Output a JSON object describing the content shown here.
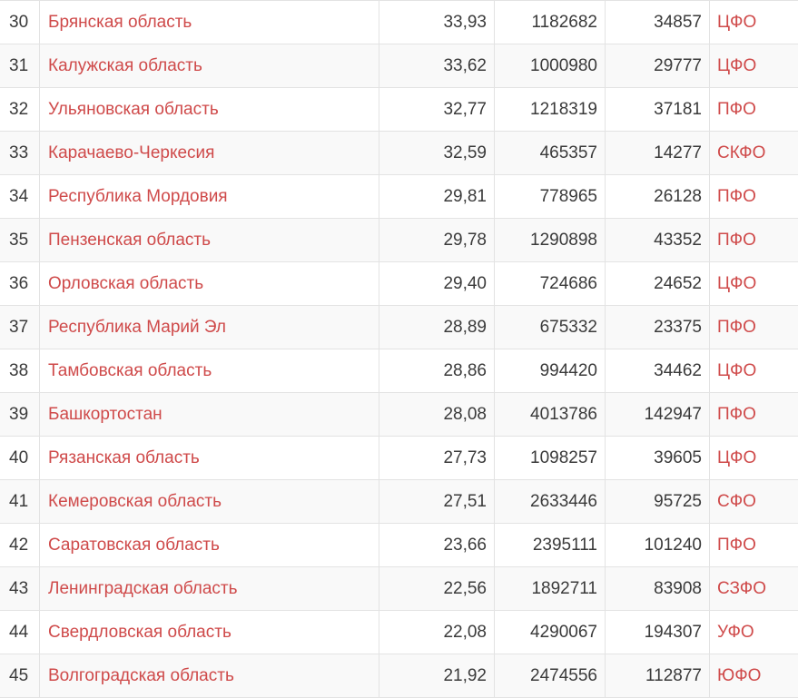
{
  "theme": {
    "link_color": "#cf4a4a",
    "text_color": "#3a3a3a",
    "border_color": "#e3e3e3",
    "stripe_color": "#f9f9f9"
  },
  "rows": [
    {
      "rank": "30",
      "name": "Брянская область",
      "percent": "33,93",
      "population": "1182682",
      "count": "34857",
      "district": "ЦФО"
    },
    {
      "rank": "31",
      "name": "Калужская область",
      "percent": "33,62",
      "population": "1000980",
      "count": "29777",
      "district": "ЦФО"
    },
    {
      "rank": "32",
      "name": "Ульяновская область",
      "percent": "32,77",
      "population": "1218319",
      "count": "37181",
      "district": "ПФО"
    },
    {
      "rank": "33",
      "name": "Карачаево-Черкесия",
      "percent": "32,59",
      "population": "465357",
      "count": "14277",
      "district": "СКФО"
    },
    {
      "rank": "34",
      "name": "Республика Мордовия",
      "percent": "29,81",
      "population": "778965",
      "count": "26128",
      "district": "ПФО"
    },
    {
      "rank": "35",
      "name": "Пензенская область",
      "percent": "29,78",
      "population": "1290898",
      "count": "43352",
      "district": "ПФО"
    },
    {
      "rank": "36",
      "name": "Орловская область",
      "percent": "29,40",
      "population": "724686",
      "count": "24652",
      "district": "ЦФО"
    },
    {
      "rank": "37",
      "name": "Республика Марий Эл",
      "percent": "28,89",
      "population": "675332",
      "count": "23375",
      "district": "ПФО"
    },
    {
      "rank": "38",
      "name": "Тамбовская область",
      "percent": "28,86",
      "population": "994420",
      "count": "34462",
      "district": "ЦФО"
    },
    {
      "rank": "39",
      "name": "Башкортостан",
      "percent": "28,08",
      "population": "4013786",
      "count": "142947",
      "district": "ПФО"
    },
    {
      "rank": "40",
      "name": "Рязанская область",
      "percent": "27,73",
      "population": "1098257",
      "count": "39605",
      "district": "ЦФО"
    },
    {
      "rank": "41",
      "name": "Кемеровская область",
      "percent": "27,51",
      "population": "2633446",
      "count": "95725",
      "district": "СФО"
    },
    {
      "rank": "42",
      "name": "Саратовская область",
      "percent": "23,66",
      "population": "2395111",
      "count": "101240",
      "district": "ПФО"
    },
    {
      "rank": "43",
      "name": "Ленинградская область",
      "percent": "22,56",
      "population": "1892711",
      "count": "83908",
      "district": "СЗФО"
    },
    {
      "rank": "44",
      "name": "Свердловская область",
      "percent": "22,08",
      "population": "4290067",
      "count": "194307",
      "district": "УФО"
    },
    {
      "rank": "45",
      "name": "Волгоградская область",
      "percent": "21,92",
      "population": "2474556",
      "count": "112877",
      "district": "ЮФО"
    }
  ]
}
